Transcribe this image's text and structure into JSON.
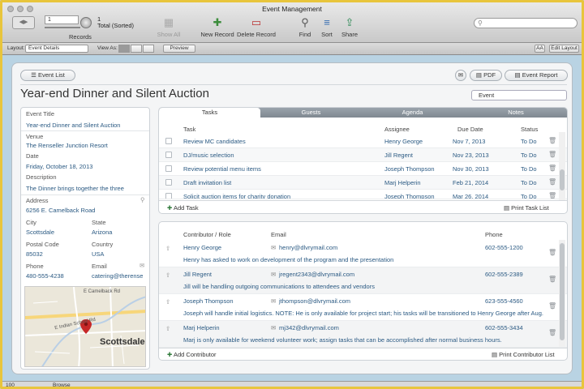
{
  "window": {
    "title": "Event Management"
  },
  "toolbar": {
    "record_number": "1",
    "record_total": "1",
    "record_state": "Total (Sorted)",
    "records_label": "Records",
    "show_all": "Show All",
    "new_record": "New Record",
    "delete_record": "Delete Record",
    "find": "Find",
    "sort": "Sort",
    "share": "Share"
  },
  "layoutbar": {
    "layout_label": "Layout:",
    "layout_value": "Event Details",
    "view_as_label": "View As:",
    "preview": "Preview",
    "font_size": "AA",
    "edit_layout": "Edit Layout"
  },
  "header": {
    "event_list": "Event List",
    "pdf": "PDF",
    "event_report": "Event Report",
    "title": "Year-end Dinner and Silent Auction",
    "type_select": "Event"
  },
  "details": {
    "event_title_label": "Event Title",
    "event_title": "Year-end Dinner and Silent Auction",
    "venue_label": "Venue",
    "venue": "The Renseller Junction Resort",
    "date_label": "Date",
    "date": "Friday, October 18, 2013",
    "description_label": "Description",
    "description": "The Dinner brings together the three",
    "address_label": "Address",
    "address": "6256 E. Camelback Road",
    "city_label": "City",
    "city": "Scottsdale",
    "state_label": "State",
    "state": "Arizona",
    "postal_label": "Postal Code",
    "postal": "85032",
    "country_label": "Country",
    "country": "USA",
    "phone_label": "Phone",
    "phone": "480-555-4238",
    "email_label": "Email",
    "email": "catering@therense",
    "map": {
      "street1": "E Camelback Rd",
      "street2": "E Indian School Rd",
      "city": "Scottsdale"
    }
  },
  "tasks": {
    "tabs": [
      "Tasks",
      "Guests",
      "Agenda",
      "Notes"
    ],
    "headers": {
      "task": "Task",
      "assignee": "Assignee",
      "due": "Due Date",
      "status": "Status"
    },
    "rows": [
      {
        "task": "Review MC candidates",
        "assignee": "Henry George",
        "due": "Nov 7, 2013",
        "status": "To Do"
      },
      {
        "task": "DJ/music selection",
        "assignee": "Jill Regent",
        "due": "Nov 23, 2013",
        "status": "To Do"
      },
      {
        "task": "Review potential menu items",
        "assignee": "Joseph Thompson",
        "due": "Nov 30, 2013",
        "status": "To Do"
      },
      {
        "task": "Draft invitation list",
        "assignee": "Marj Helperin",
        "due": "Feb 21, 2014",
        "status": "To Do"
      },
      {
        "task": "Solicit auction items for charity donation",
        "assignee": "Joseph Thompson",
        "due": "Mar 26, 2014",
        "status": "To Do"
      }
    ],
    "add": "Add Task",
    "print": "Print Task List"
  },
  "contributors": {
    "headers": {
      "name": "Contributor / Role",
      "email": "Email",
      "phone": "Phone"
    },
    "rows": [
      {
        "name": "Henry George",
        "email": "henry@dlvrymail.com",
        "phone": "602-555-1200",
        "note": "Henry has asked to work on development of the program and the presentation"
      },
      {
        "name": "Jill Regent",
        "email": "jregent2343@dlvrymail.com",
        "phone": "602-555-2389",
        "note": "Jill will be handling outgoing communications to attendees and vendors"
      },
      {
        "name": "Joseph Thompson",
        "email": "jthompson@dlvrymail.com",
        "phone": "623-555-4560",
        "note": "Joseph will handle initial logistics. NOTE: He is only available for project start; his tasks will be transitioned to Henry George after Aug."
      },
      {
        "name": "Marj Helperin",
        "email": "mj342@dlvrymail.com",
        "phone": "602-555-3434",
        "note": "Marj is only available for weekend volunteer work; assign tasks that can be accomplished after normal business hours."
      }
    ],
    "add": "Add Contributor",
    "print": "Print Contributor List"
  },
  "status": {
    "zoom": "100",
    "mode": "Browse"
  },
  "colors": {
    "frame": "#e8c53c",
    "background": "#b9d3e3",
    "link": "#2b5a83",
    "tab_bar": "#8a939b"
  }
}
